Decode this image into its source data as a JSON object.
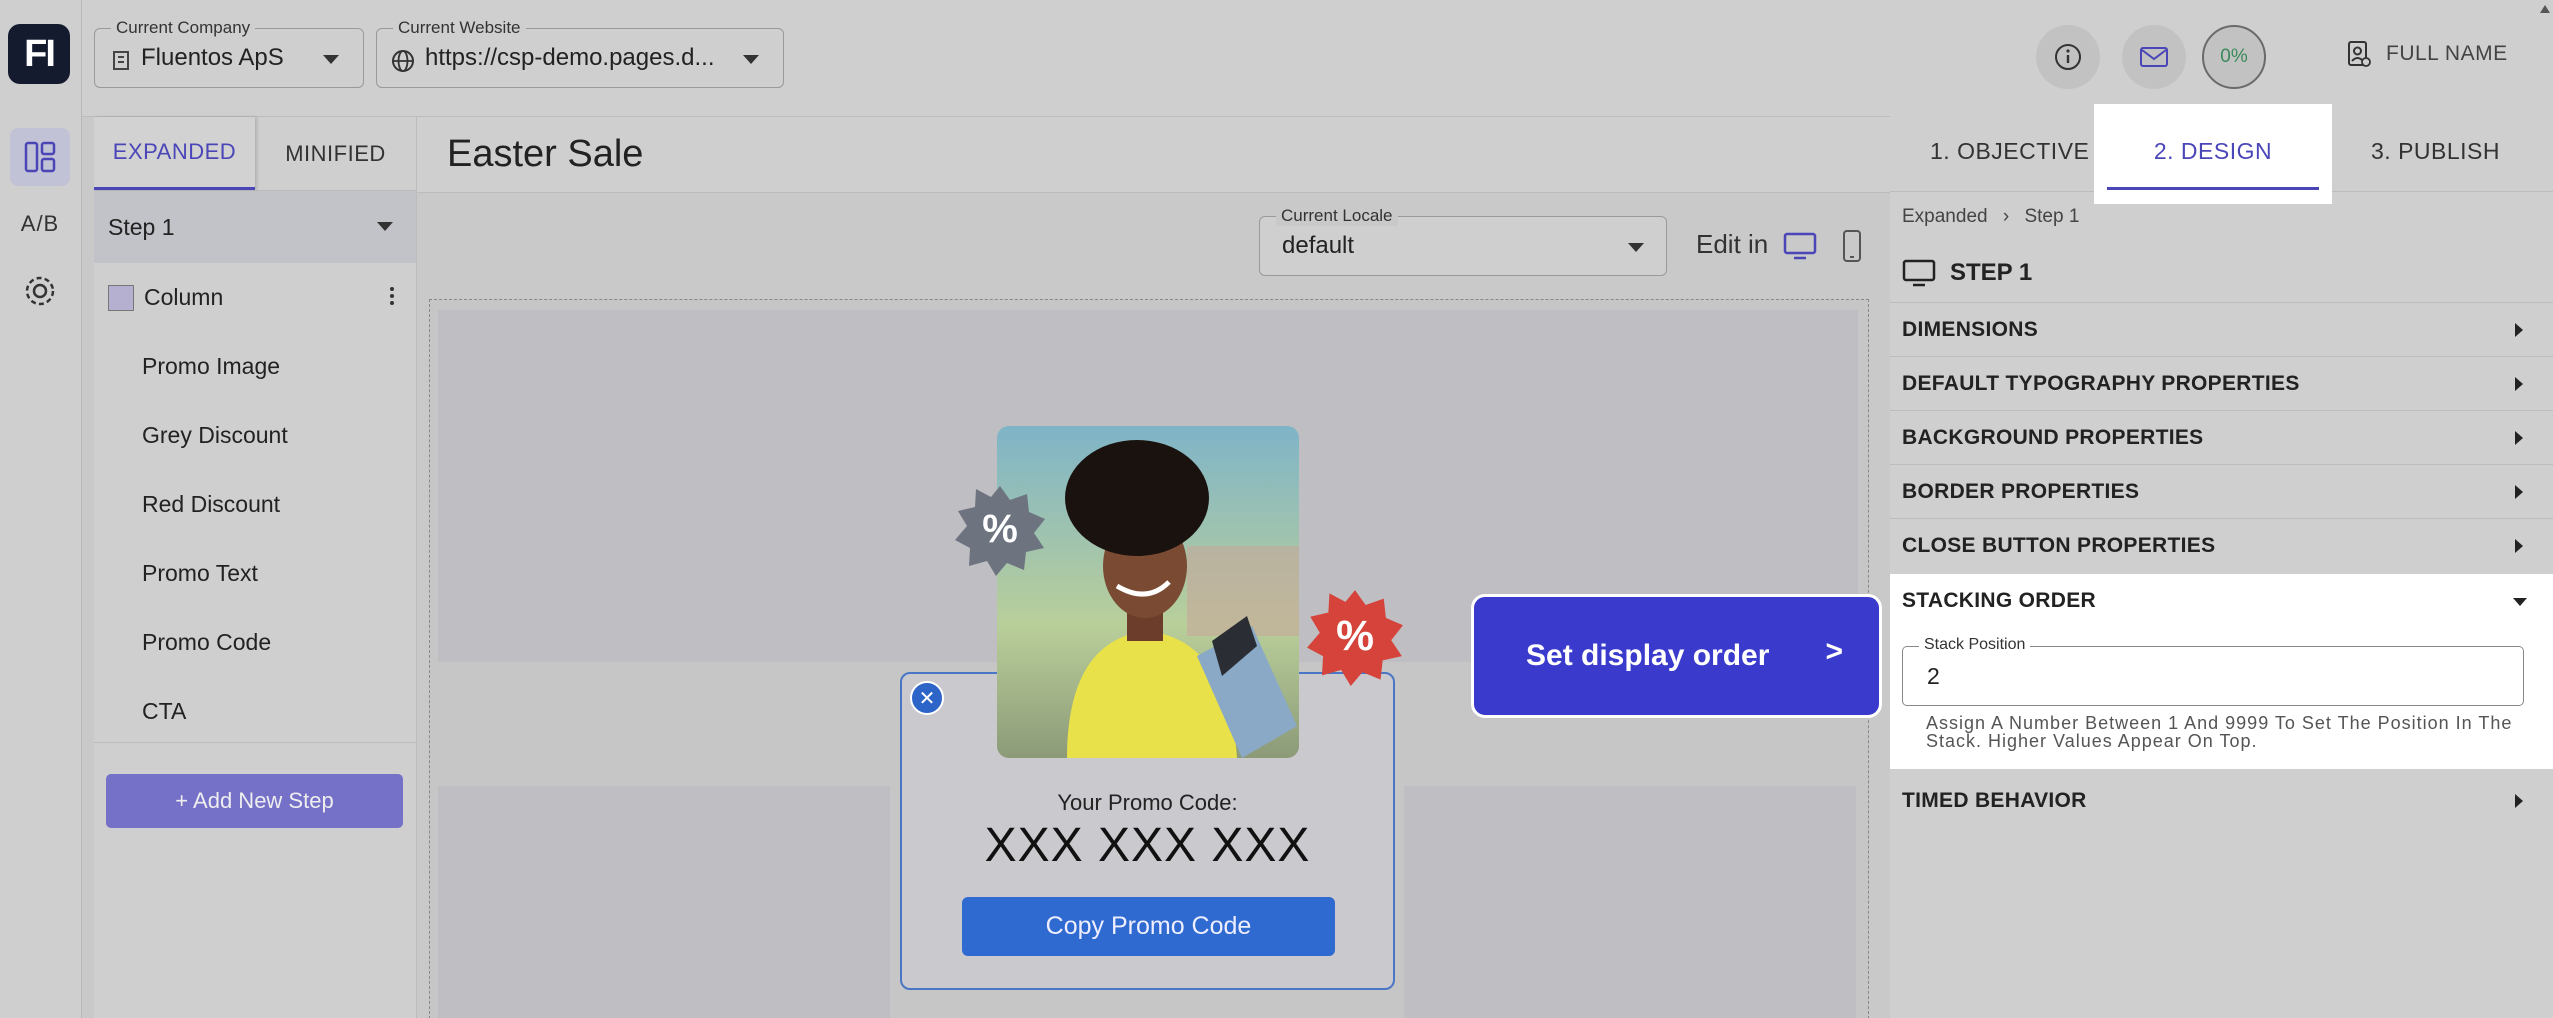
{
  "rail": {
    "logo": "FI",
    "ab_label": "A/B"
  },
  "topbar": {
    "company_label": "Current Company",
    "company_value": "Fluentos ApS",
    "website_label": "Current Website",
    "website_value": "https://csp-demo.pages.d..."
  },
  "structure": {
    "tabs": [
      "EXPANDED",
      "MINIFIED"
    ],
    "step_select": "Step 1",
    "column_label": "Column",
    "items": [
      "Promo Image",
      "Grey Discount",
      "Red Discount",
      "Promo Text",
      "Promo Code",
      "CTA"
    ],
    "add_step": "+ Add New Step"
  },
  "editor": {
    "title": "Easter Sale",
    "locale_label": "Current Locale",
    "locale_value": "default",
    "edit_in": "Edit in"
  },
  "popup": {
    "badge_text": "%",
    "label": "Your Promo Code:",
    "code": "XXX XXX XXX",
    "copy_button": "Copy Promo Code"
  },
  "callout": {
    "label": "Set display order",
    "arrow": ">"
  },
  "right": {
    "progress": "0%",
    "user_name": "FULL NAME",
    "tabs": [
      "1. OBJECTIVE",
      "2. DESIGN",
      "3. PUBLISH"
    ],
    "breadcrumb": [
      "Expanded",
      "Step 1"
    ],
    "step_title": "STEP 1",
    "sections": [
      "DIMENSIONS",
      "DEFAULT TYPOGRAPHY PROPERTIES",
      "BACKGROUND PROPERTIES",
      "BORDER PROPERTIES",
      "CLOSE BUTTON PROPERTIES",
      "STACKING ORDER",
      "TIMED BEHAVIOR"
    ],
    "stack_label": "Stack Position",
    "stack_value": "2",
    "stack_help": "Assign A Number Between 1 And 9999 To Set The Position In The Stack. Higher Values Appear On Top."
  },
  "colors": {
    "accent": "#4a46b8",
    "callout": "#3a3acc",
    "copy_button": "#2f6ad0"
  }
}
